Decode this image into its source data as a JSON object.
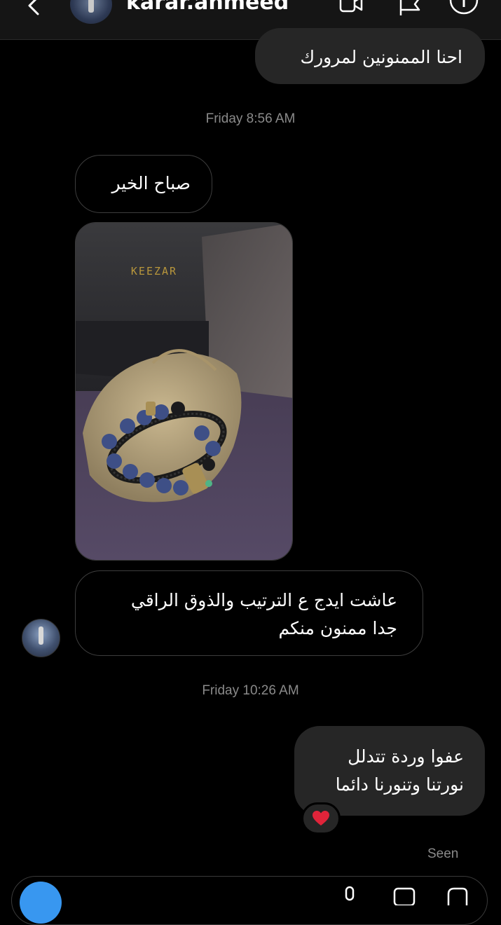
{
  "header": {
    "username": "karar.ahmeed",
    "icons": [
      "back-icon",
      "video-call-icon",
      "flag-icon",
      "info-icon"
    ]
  },
  "messages": [
    {
      "type": "sent",
      "lines": [
        "احنا الممنونين لمرورك"
      ]
    },
    {
      "type": "timestamp",
      "text": "Friday 8:56 AM"
    },
    {
      "type": "received",
      "lines": [
        "صباح الخير"
      ]
    },
    {
      "type": "received-photo",
      "brand_text": "KEEZAR"
    },
    {
      "type": "received",
      "lines": [
        "عاشت ايدج ع الترتيب والذوق الراقي",
        "جدا ممنون منكم"
      ]
    },
    {
      "type": "timestamp",
      "text": "Friday 10:26 AM"
    },
    {
      "type": "sent",
      "lines": [
        "عفوا وردة تتدلل",
        "نورتنا وتنورنا دائما"
      ],
      "reaction": "❤️"
    }
  ],
  "status": {
    "seen": "Seen"
  },
  "composer": {
    "icons": [
      "camera-icon",
      "mic-icon",
      "gallery-icon",
      "sticker-icon"
    ]
  },
  "colors": {
    "background": "#000000",
    "sent_bubble": "#262626",
    "received_border": "#3d3d3d",
    "timestamp": "#8a8a8a",
    "accent": "#3897f0",
    "heart": "#e0243a"
  }
}
